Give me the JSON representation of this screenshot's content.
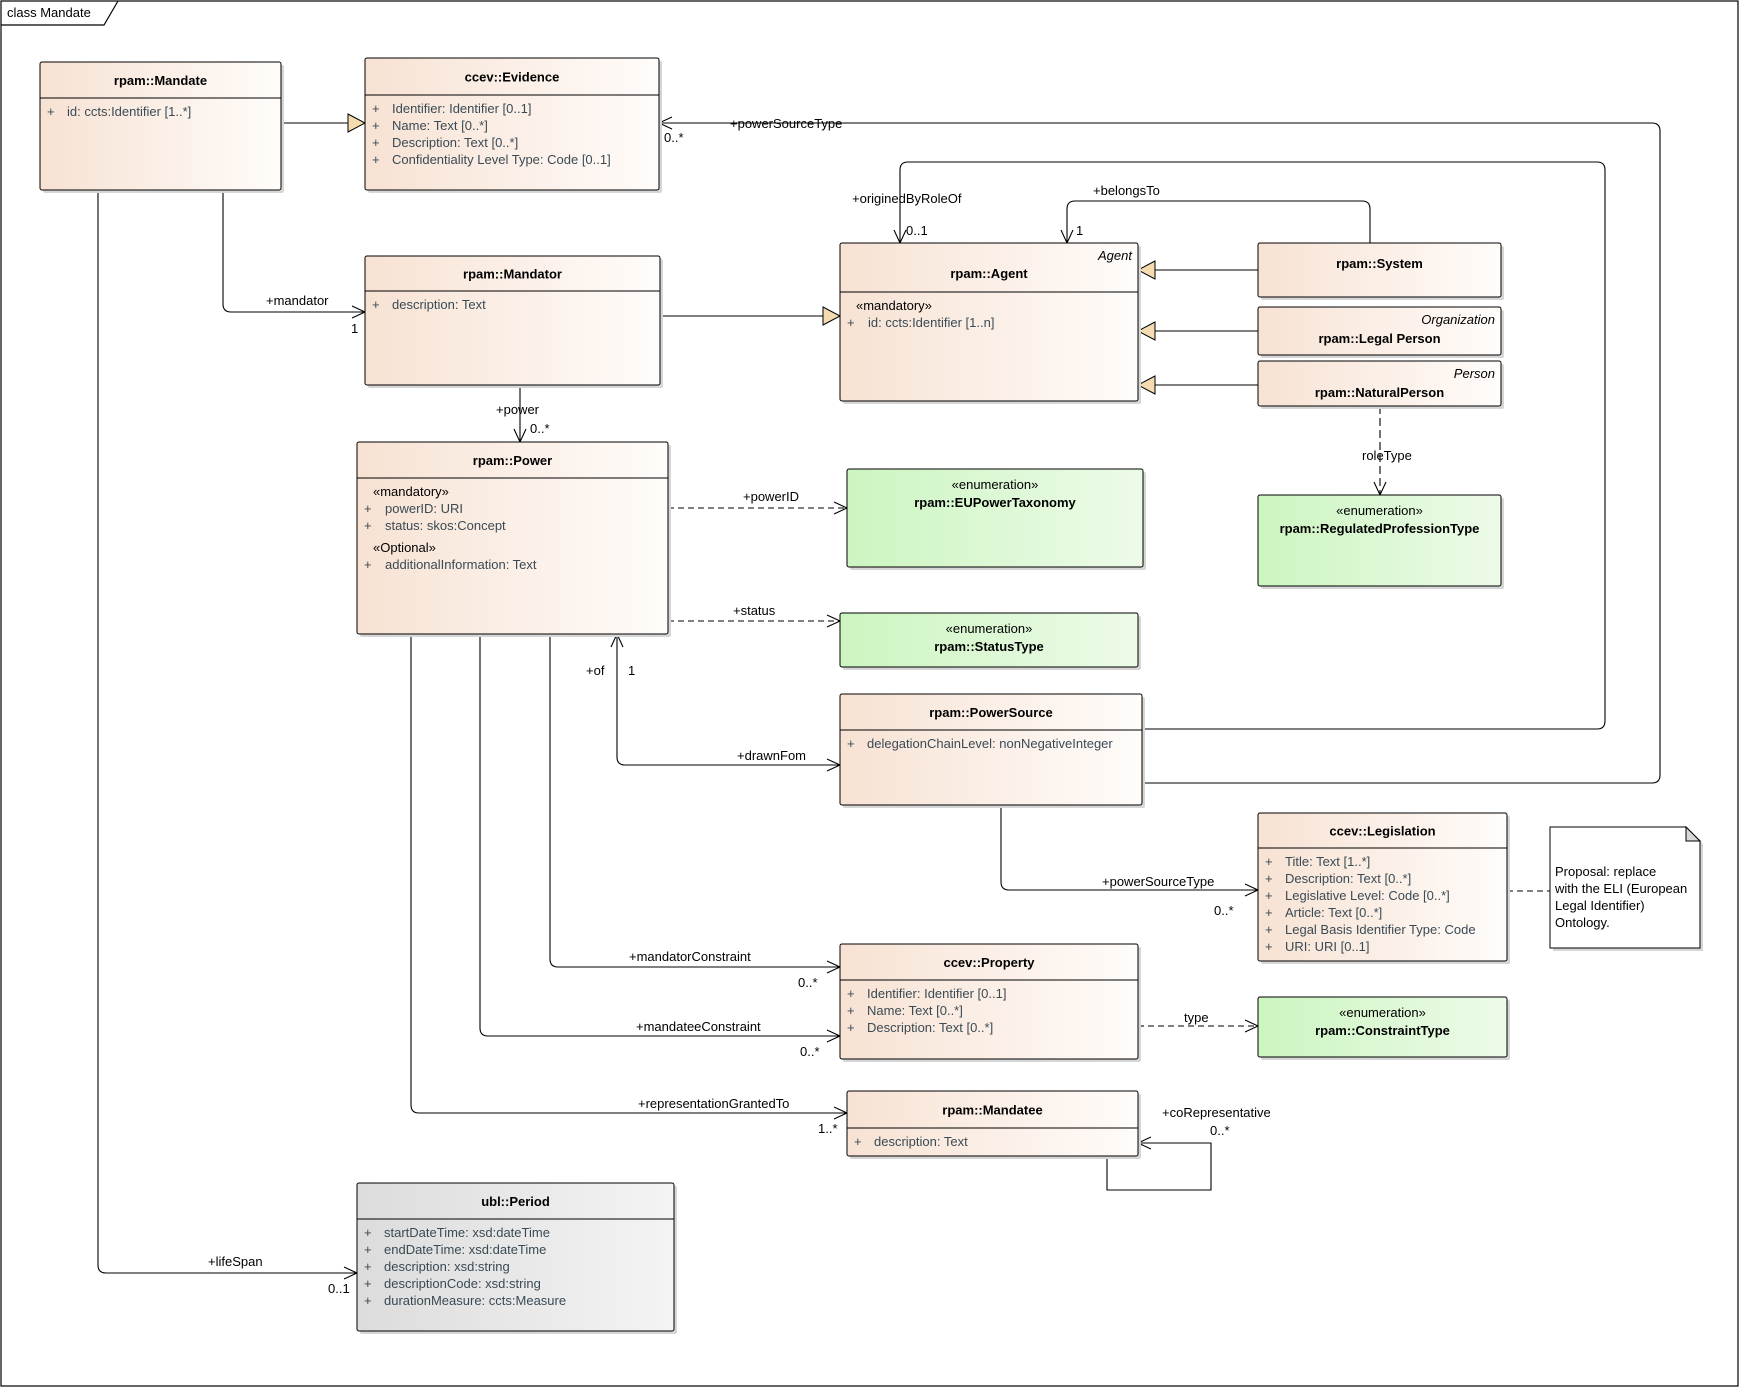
{
  "frame": {
    "label": "class Mandate"
  },
  "classes": {
    "mandate": {
      "title": "rpam::Mandate",
      "attributes": [
        {
          "vis": "+",
          "text": "id: ccts:Identifier [1..*]"
        }
      ]
    },
    "evidence": {
      "title": "ccev::Evidence",
      "attributes": [
        {
          "vis": "+",
          "text": "Identifier: Identifier [0..1]"
        },
        {
          "vis": "+",
          "text": "Name: Text [0..*]"
        },
        {
          "vis": "+",
          "text": "Description: Text [0..*]"
        },
        {
          "vis": "+",
          "text": "Confidentiality Level Type: Code [0..1]"
        }
      ]
    },
    "mandator": {
      "title": "rpam::Mandator",
      "attributes": [
        {
          "vis": "+",
          "text": "description: Text"
        }
      ]
    },
    "agent": {
      "title": "rpam::Agent",
      "alias": "Agent",
      "groups": [
        {
          "stereotype": "«mandatory»",
          "attributes": [
            {
              "vis": "+",
              "text": "id: ccts:Identifier [1..n]"
            }
          ]
        }
      ]
    },
    "system": {
      "title": "rpam::System"
    },
    "legalPerson": {
      "title": "rpam::Legal Person",
      "alias": "Organization"
    },
    "naturalPerson": {
      "title": "rpam::NaturalPerson",
      "alias": "Person"
    },
    "power": {
      "title": "rpam::Power",
      "groups": [
        {
          "stereotype": "«mandatory»",
          "attributes": [
            {
              "vis": "+",
              "text": "powerID: URI"
            },
            {
              "vis": "+",
              "text": "status: skos:Concept"
            }
          ]
        },
        {
          "stereotype": "«Optional»",
          "attributes": [
            {
              "vis": "+",
              "text": "additionalInformation: Text"
            }
          ]
        }
      ]
    },
    "powerSource": {
      "title": "rpam::PowerSource",
      "attributes": [
        {
          "vis": "+",
          "text": "delegationChainLevel: nonNegativeInteger"
        }
      ]
    },
    "legislation": {
      "title": "ccev::Legislation",
      "attributes": [
        {
          "vis": "+",
          "text": "Title: Text [1..*]"
        },
        {
          "vis": "+",
          "text": "Description: Text [0..*]"
        },
        {
          "vis": "+",
          "text": "Legislative Level: Code [0..*]"
        },
        {
          "vis": "+",
          "text": "Article: Text [0..*]"
        },
        {
          "vis": "+",
          "text": "Legal Basis Identifier Type: Code"
        },
        {
          "vis": "+",
          "text": "URI: URI [0..1]"
        }
      ]
    },
    "property": {
      "title": "ccev::Property",
      "attributes": [
        {
          "vis": "+",
          "text": "Identifier: Identifier [0..1]"
        },
        {
          "vis": "+",
          "text": "Name: Text [0..*]"
        },
        {
          "vis": "+",
          "text": "Description: Text [0..*]"
        }
      ]
    },
    "mandatee": {
      "title": "rpam::Mandatee",
      "attributes": [
        {
          "vis": "+",
          "text": "description: Text"
        }
      ]
    },
    "period": {
      "title": "ubl::Period",
      "attributes": [
        {
          "vis": "+",
          "text": "startDateTime: xsd:dateTime"
        },
        {
          "vis": "+",
          "text": "endDateTime: xsd:dateTime"
        },
        {
          "vis": "+",
          "text": "description: xsd:string"
        },
        {
          "vis": "+",
          "text": "descriptionCode: xsd:string"
        },
        {
          "vis": "+",
          "text": "durationMeasure: ccts:Measure"
        }
      ]
    }
  },
  "enumerations": {
    "euPowerTaxonomy": {
      "stereotype": "«enumeration»",
      "title": "rpam::EUPowerTaxonomy"
    },
    "statusType": {
      "stereotype": "«enumeration»",
      "title": "rpam::StatusType"
    },
    "regulatedProfessionType": {
      "stereotype": "«enumeration»",
      "title": "rpam::RegulatedProfessionType"
    },
    "constraintType": {
      "stereotype": "«enumeration»",
      "title": "rpam::ConstraintType"
    }
  },
  "note": {
    "lines": [
      "Proposal: replace",
      "with the ELI (European",
      "Legal Identifier)",
      "Ontology."
    ]
  },
  "connectors": {
    "powerSourceType_top": {
      "role": "+powerSourceType",
      "mult": "0..*"
    },
    "originedByRoleOf": {
      "role": "+originedByRoleOf",
      "mult": "0..1"
    },
    "belongsTo": {
      "role": "+belongsTo",
      "mult": "1"
    },
    "mandator": {
      "role": "+mandator",
      "mult": "1"
    },
    "power": {
      "role": "+power",
      "mult": "0..*"
    },
    "powerID": {
      "role": "+powerID"
    },
    "status": {
      "role": "+status"
    },
    "roleType": {
      "role": "roleType"
    },
    "of": {
      "role": "+of",
      "mult": "1"
    },
    "drawnFom": {
      "role": "+drawnFom"
    },
    "powerSourceType_bottom": {
      "role": "+powerSourceType",
      "mult": "0..*"
    },
    "mandatorConstraint": {
      "role": "+mandatorConstraint",
      "mult": "0..*"
    },
    "mandateeConstraint": {
      "role": "+mandateeConstraint",
      "mult": "0..*"
    },
    "type": {
      "role": "type"
    },
    "representationGrantedTo": {
      "role": "+representationGrantedTo",
      "mult": "1..*"
    },
    "coRepresentative": {
      "role": "+coRepresentative",
      "mult": "0..*"
    },
    "lifeSpan": {
      "role": "+lifeSpan",
      "mult": "0..1"
    }
  },
  "colors": {
    "class_fill_left": "#f7e2d3",
    "class_fill_right": "#fffcfa",
    "enum_fill_left": "#ccf5c0",
    "enum_fill_right": "#edfbe9",
    "datatype_fill_left": "#dcdcdc",
    "datatype_fill_right": "#f4f4f4",
    "generalization_arrow": "#f5dcb0"
  }
}
